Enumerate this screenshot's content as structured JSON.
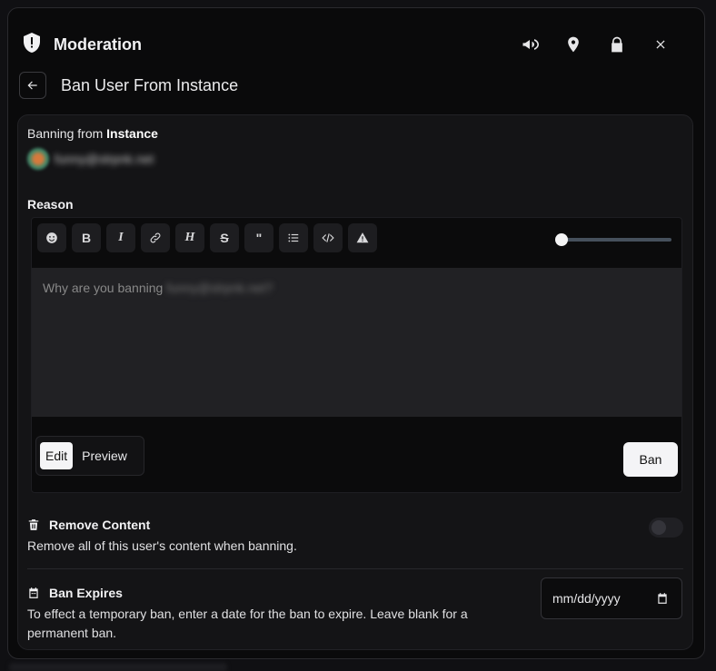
{
  "header": {
    "title": "Moderation",
    "icons": [
      "shield-icon",
      "megaphone-icon",
      "map-pin-icon",
      "lock-icon",
      "close-icon"
    ]
  },
  "subheader": {
    "title": "Ban User From Instance"
  },
  "target": {
    "prefix": "Banning from",
    "scope": "Instance",
    "username": "funny@slrpnk.net"
  },
  "reason": {
    "label": "Reason",
    "toolbar": [
      "emoji",
      "bold",
      "italic",
      "link",
      "header",
      "strikethrough",
      "quote",
      "list",
      "code",
      "spoiler"
    ],
    "toolbar_glyphs": {
      "bold": "B",
      "italic": "I",
      "header": "H",
      "strike": "S",
      "quote": "\""
    },
    "placeholder_prefix": "Why are you banning",
    "placeholder_user": "funny@slrpnk.net?",
    "tabs": [
      "Edit",
      "Preview"
    ],
    "active_tab": "Edit",
    "submit_label": "Ban"
  },
  "remove_content": {
    "title": "Remove Content",
    "description": "Remove all of this user's content when banning.",
    "enabled": false
  },
  "ban_expires": {
    "title": "Ban Expires",
    "description": "To effect a temporary ban, enter a date for the ban to expire. Leave blank for a permanent ban.",
    "date_placeholder": "mm/dd/yyyy"
  },
  "colors": {
    "background": "#0a0a0b",
    "card": "#141416",
    "accent_button": "#f4f4f6"
  }
}
